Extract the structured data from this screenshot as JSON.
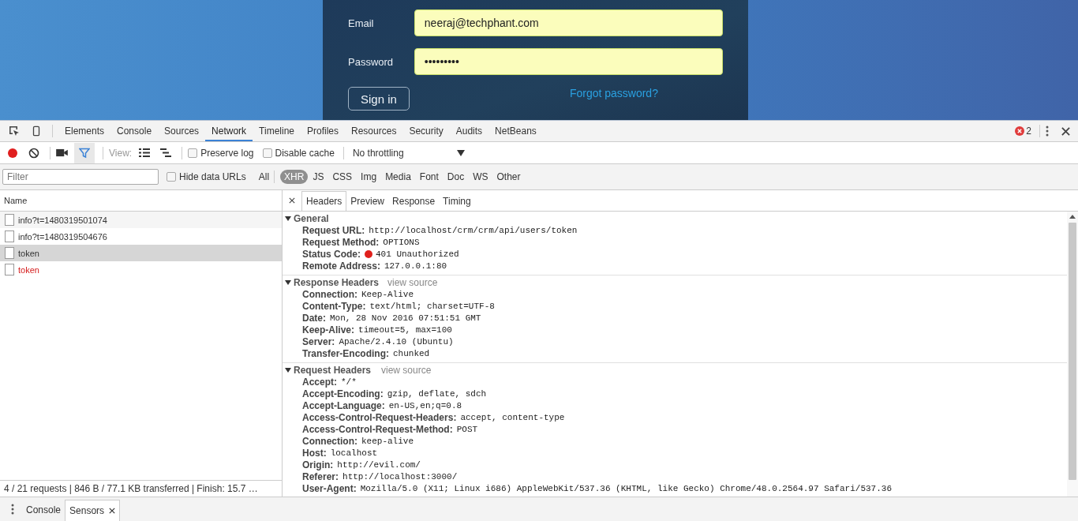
{
  "login_form": {
    "email_label": "Email",
    "email_value": "neeraj@techphant.com",
    "password_label": "Password",
    "password_value": "•••••••••",
    "sign_in": "Sign in",
    "forgot_password": "Forgot password?"
  },
  "devtools": {
    "tabs": [
      {
        "label": "Elements",
        "selected": false
      },
      {
        "label": "Console",
        "selected": false
      },
      {
        "label": "Sources",
        "selected": false
      },
      {
        "label": "Network",
        "selected": true
      },
      {
        "label": "Timeline",
        "selected": false
      },
      {
        "label": "Profiles",
        "selected": false
      },
      {
        "label": "Resources",
        "selected": false
      },
      {
        "label": "Security",
        "selected": false
      },
      {
        "label": "Audits",
        "selected": false
      },
      {
        "label": "NetBeans",
        "selected": false
      }
    ],
    "error_count": "2",
    "toolbar": {
      "recording": true,
      "filter_active": true,
      "view_label": "View:",
      "preserve_log": {
        "label": "Preserve log",
        "checked": false
      },
      "disable_cache": {
        "label": "Disable cache",
        "checked": false
      },
      "throttling": "No throttling"
    },
    "filter": {
      "placeholder": "Filter",
      "hide_data_urls": {
        "label": "Hide data URLs",
        "checked": false
      },
      "types": [
        {
          "label": "All",
          "selected": false
        },
        {
          "label": "XHR",
          "selected": true
        },
        {
          "label": "JS",
          "selected": false
        },
        {
          "label": "CSS",
          "selected": false
        },
        {
          "label": "Img",
          "selected": false
        },
        {
          "label": "Media",
          "selected": false
        },
        {
          "label": "Font",
          "selected": false
        },
        {
          "label": "Doc",
          "selected": false
        },
        {
          "label": "WS",
          "selected": false
        },
        {
          "label": "Other",
          "selected": false
        }
      ]
    },
    "requests": {
      "column": "Name",
      "rows": [
        {
          "name": "info?t=1480319501074",
          "selected": false,
          "failed": false
        },
        {
          "name": "info?t=1480319504676",
          "selected": false,
          "failed": false
        },
        {
          "name": "token",
          "selected": true,
          "failed": false
        },
        {
          "name": "token",
          "selected": false,
          "failed": true
        }
      ]
    },
    "status_bar": "4 / 21 requests  |  846 B / 77.1 KB transferred  |  Finish: 15.7 …",
    "details": {
      "tabs": [
        {
          "label": "Headers",
          "selected": true
        },
        {
          "label": "Preview",
          "selected": false
        },
        {
          "label": "Response",
          "selected": false
        },
        {
          "label": "Timing",
          "selected": false
        }
      ],
      "sections": [
        {
          "title": "General",
          "expanded": true,
          "rows": [
            {
              "key": "Request URL:",
              "value": "http://localhost/crm/crm/api/users/token"
            },
            {
              "key": "Request Method:",
              "value": "OPTIONS"
            },
            {
              "key": "Status Code:",
              "value": "401 Unauthorized",
              "color": "#e0201c"
            },
            {
              "key": "Remote Address:",
              "value": "127.0.0.1:80"
            }
          ]
        },
        {
          "title": "Response Headers",
          "view_source": "view source",
          "expanded": true,
          "rows": [
            {
              "key": "Connection:",
              "value": "Keep-Alive"
            },
            {
              "key": "Content-Type:",
              "value": "text/html; charset=UTF-8"
            },
            {
              "key": "Date:",
              "value": "Mon, 28 Nov 2016 07:51:51 GMT"
            },
            {
              "key": "Keep-Alive:",
              "value": "timeout=5, max=100"
            },
            {
              "key": "Server:",
              "value": "Apache/2.4.10 (Ubuntu)"
            },
            {
              "key": "Transfer-Encoding:",
              "value": "chunked"
            }
          ]
        },
        {
          "title": "Request Headers",
          "view_source": "view source",
          "expanded": true,
          "rows": [
            {
              "key": "Accept:",
              "value": "*/*"
            },
            {
              "key": "Accept-Encoding:",
              "value": "gzip, deflate, sdch"
            },
            {
              "key": "Accept-Language:",
              "value": "en-US,en;q=0.8"
            },
            {
              "key": "Access-Control-Request-Headers:",
              "value": "accept, content-type"
            },
            {
              "key": "Access-Control-Request-Method:",
              "value": "POST"
            },
            {
              "key": "Connection:",
              "value": "keep-alive"
            },
            {
              "key": "Host:",
              "value": "localhost"
            },
            {
              "key": "Origin:",
              "value": "http://evil.com/"
            },
            {
              "key": "Referer:",
              "value": "http://localhost:3000/"
            },
            {
              "key": "User-Agent:",
              "value": "Mozilla/5.0 (X11; Linux i686) AppleWebKit/537.36 (KHTML, like Gecko) Chrome/48.0.2564.97 Safari/537.36"
            }
          ]
        }
      ]
    },
    "drawer": {
      "tabs": [
        {
          "label": "Console",
          "selected": false,
          "closable": false
        },
        {
          "label": "Sensors",
          "selected": true,
          "closable": true
        }
      ]
    }
  }
}
